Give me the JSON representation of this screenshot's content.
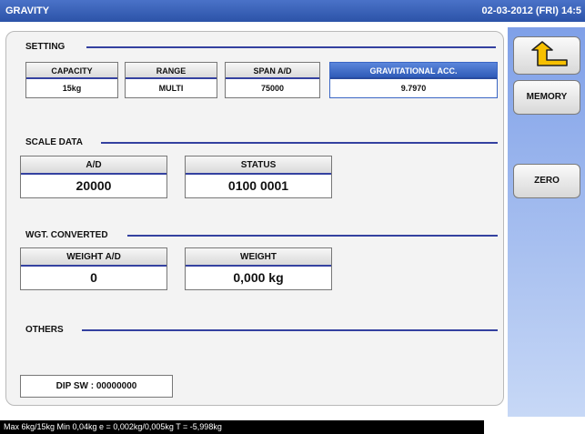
{
  "titlebar": {
    "title": "GRAVITY",
    "datetime": "02-03-2012 (FRI) 14:5"
  },
  "setting": {
    "header": "SETTING",
    "boxes": [
      {
        "label": "CAPACITY",
        "value": "15kg"
      },
      {
        "label": "RANGE",
        "value": "MULTI"
      },
      {
        "label": "SPAN A/D",
        "value": "75000"
      },
      {
        "label": "GRAVITATIONAL ACC.",
        "value": "9.7970"
      }
    ]
  },
  "scale_data": {
    "header": "SCALE DATA",
    "boxes": [
      {
        "label": "A/D",
        "value": "20000"
      },
      {
        "label": "STATUS",
        "value": "0100 0001"
      }
    ]
  },
  "wgt_converted": {
    "header": "WGT. CONVERTED",
    "boxes": [
      {
        "label": "WEIGHT A/D",
        "value": "0"
      },
      {
        "label": "WEIGHT",
        "value": "0,000 kg"
      }
    ]
  },
  "others": {
    "header": "OTHERS",
    "dip": "DIP SW : 00000000"
  },
  "sidebar": {
    "back_icon": "return-arrow-icon",
    "memory": "MEMORY",
    "zero": "ZERO"
  },
  "status_bar": "Max 6kg/15kg  Min 0,04kg  e = 0,002kg/0,005kg  T = -5,998kg",
  "colors": {
    "accent": "#3441a0",
    "titlebar": "#2c53a8",
    "sidebar": "#9db6ee"
  }
}
